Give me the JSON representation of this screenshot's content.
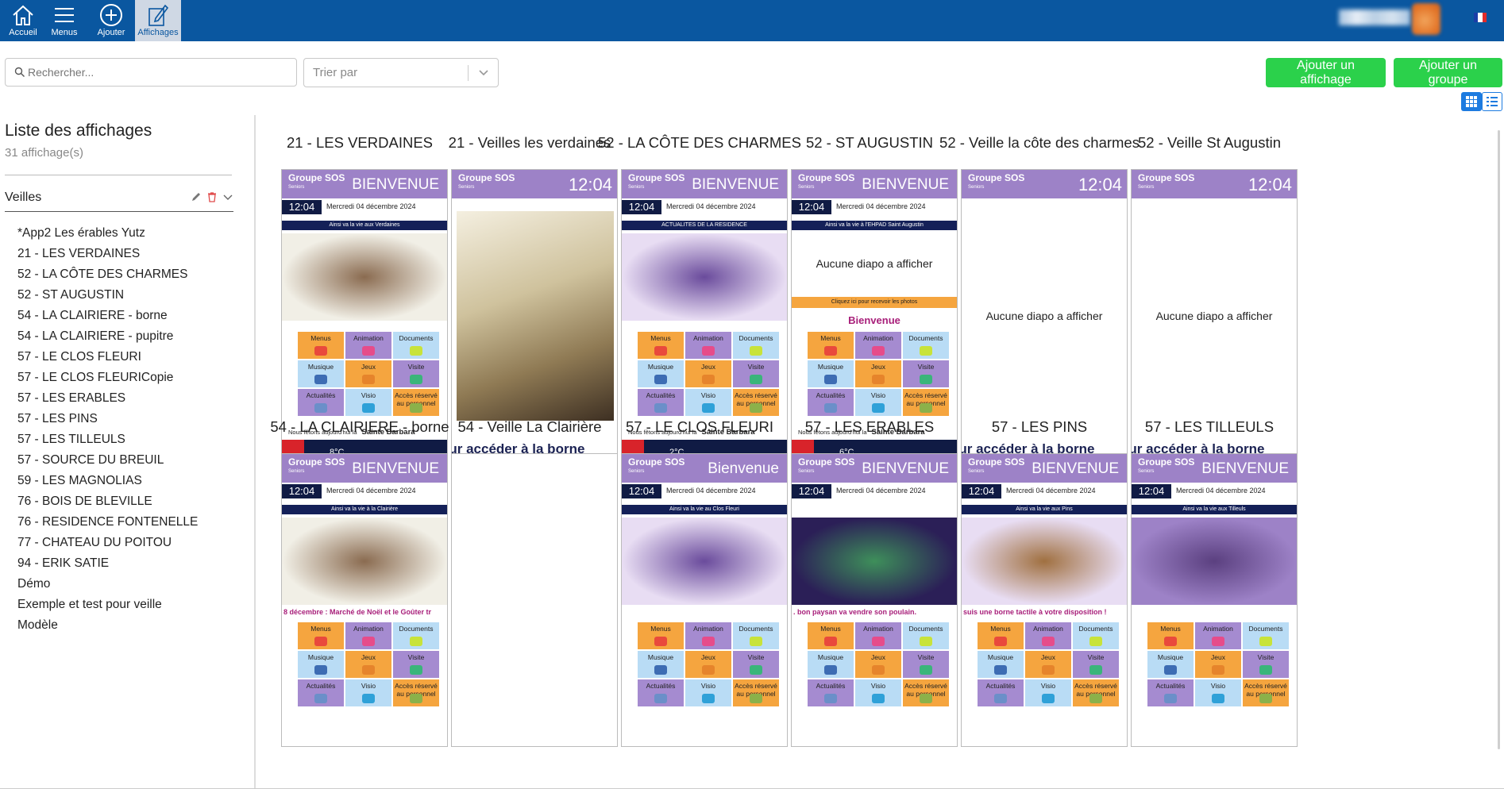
{
  "nav": [
    {
      "label": "Accueil",
      "icon": "home-icon"
    },
    {
      "label": "Menus",
      "icon": "menu-icon"
    },
    {
      "label": "Ajouter",
      "icon": "add-circle-icon"
    },
    {
      "label": "Affichages",
      "icon": "edit-display-icon"
    }
  ],
  "toolbar": {
    "search_placeholder": "Rechercher...",
    "sort_placeholder": "Trier par",
    "add_display_label": "Ajouter un affichage",
    "add_group_label": "Ajouter un groupe"
  },
  "sidebar": {
    "title": "Liste des affichages",
    "count": "31 affichage(s)",
    "group_name": "Veilles",
    "items": [
      "*App2 Les érables Yutz",
      "21 - LES VERDAINES",
      "52 - LA CÔTE DES CHARMES",
      "52 - ST AUGUSTIN",
      "54 - LA CLAIRIERE - borne",
      "54 - LA CLAIRIERE - pupitre",
      "57 - LE CLOS FLEURI",
      "57 - LE CLOS FLEURICopie",
      "57 - LES ERABLES",
      "57 - LES PINS",
      "57 - LES TILLEULS",
      "57 - SOURCE DU BREUIL",
      "59 - LES MAGNOLIAS",
      "76 - BOIS DE BLEVILLE",
      "76 - RESIDENCE FONTENELLE",
      "77 - CHATEAU DU POITOU",
      "94 - ERIK SATIE",
      "Démo",
      "Exemple et test pour veille",
      "Modèle"
    ]
  },
  "screen_text": {
    "brand": "Groupe SOS",
    "brand_sub": "Seniors",
    "welcome": "BIENVENUE",
    "welcome_alt": "Bienvenue",
    "time": "12:04",
    "date": "Mercredi 04 décembre 2024",
    "empty": "Aucune diapo a afficher",
    "borne": "our accéder à la borne",
    "saint_prefix": "Nous fêtons aujourd'hui la",
    "saint": "Sainte Barbara",
    "tiles": [
      "Menus",
      "Animation",
      "Documents",
      "Musique",
      "Jeux",
      "Visite",
      "Actualités",
      "Visio",
      "Accès réservé au personnel"
    ],
    "photos_link": "Cliquez ici pour recevoir les photos"
  },
  "cards": [
    {
      "title": "21 - LES VERDAINES",
      "band": "Ainsi va la vie aux Verdaines",
      "temp": "8°C"
    },
    {
      "title": "21 - Veilles les verdaines"
    },
    {
      "title": "52 - LA CÔTE DES CHARMES",
      "band": "ACTUALITES DE LA RESIDENCE",
      "temp": "2°C"
    },
    {
      "title": "52 - ST AUGUSTIN",
      "band": "Ainsi va la vie à l'EHPAD Saint Augustin",
      "temp": "6°C"
    },
    {
      "title": "52 - Veille la côte des charmes"
    },
    {
      "title": "52 - Veille St Augustin"
    },
    {
      "title": "54 - LA CLAIRIERE - borne",
      "band": "Ainsi va la vie à la Clairière",
      "note": "8 décembre : Marché de Noël et le Goûter tr"
    },
    {
      "title": "54 - Veille La Clairière"
    },
    {
      "title": "57 - LE CLOS FLEURI",
      "band": "Ainsi va la vie au Clos Fleuri"
    },
    {
      "title": "57 - LES ERABLES",
      "note": ". bon paysan va vendre son poulain."
    },
    {
      "title": "57 - LES PINS",
      "band": "Ainsi va la vie aux Pins",
      "note": "suis une borne tactile à votre disposition !"
    },
    {
      "title": "57 - LES TILLEULS",
      "band": "Ainsi va la vie aux Tilleuls"
    }
  ],
  "colors": {
    "topbar": "#0a57a0",
    "green": "#2bd14b",
    "purple": "#9d82c7",
    "navy": "#101b44",
    "orange": "#f5a53f"
  }
}
